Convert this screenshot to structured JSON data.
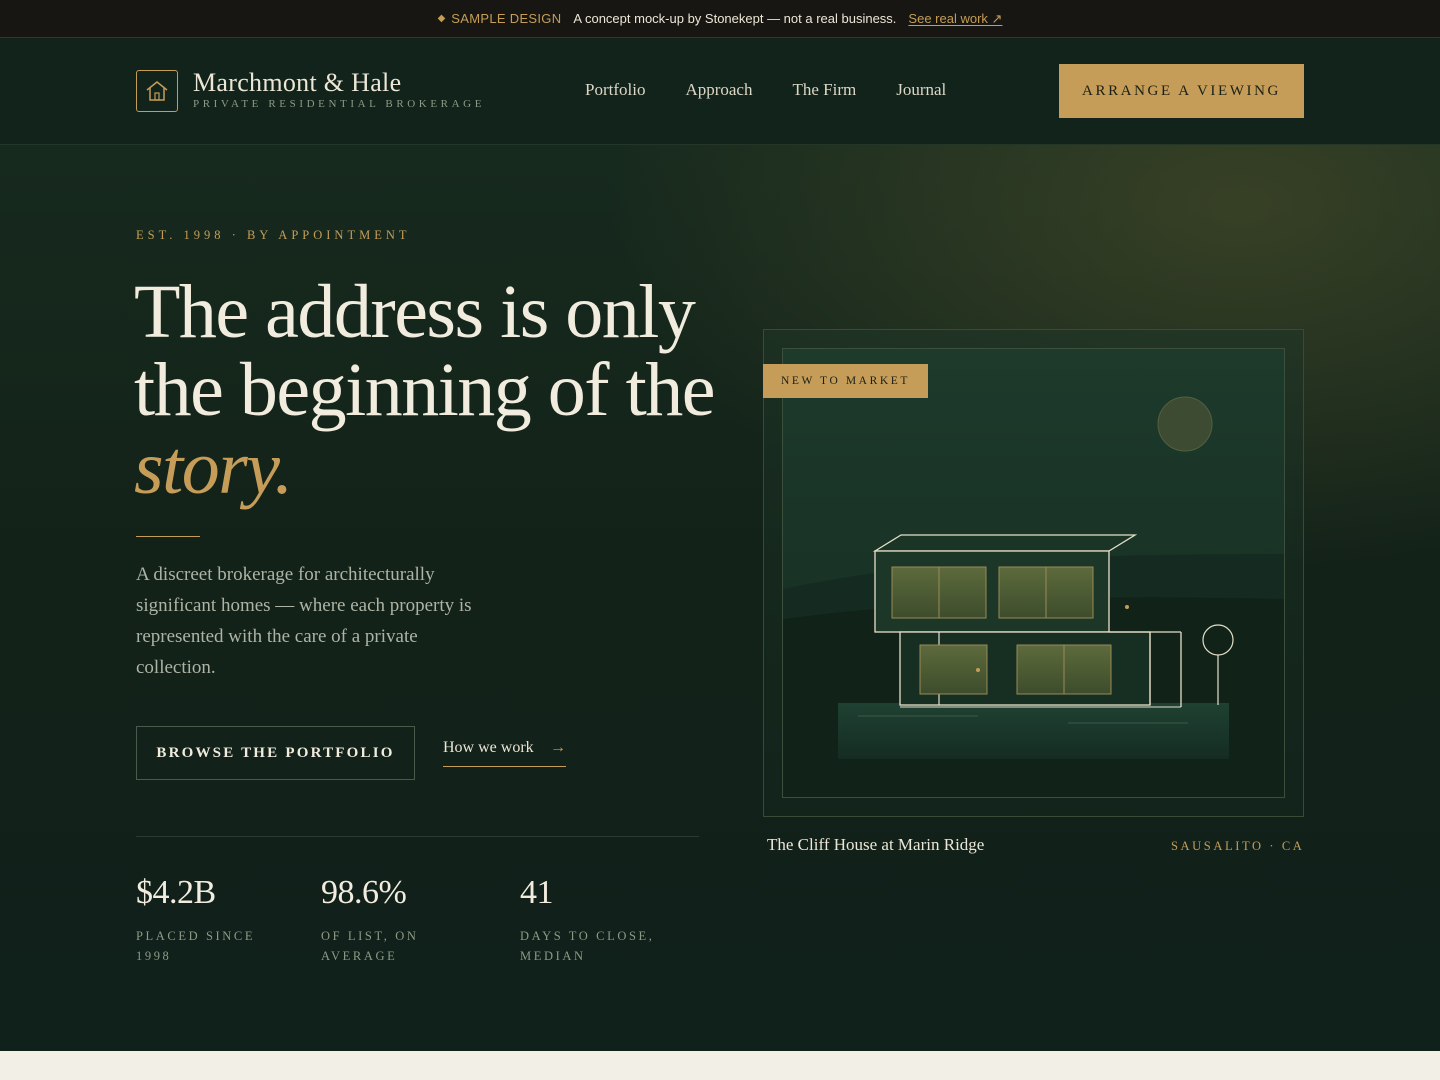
{
  "banner": {
    "tag": "SAMPLE DESIGN",
    "message": "A concept mock-up by Stonekept — not a real business.",
    "link": "See real work ↗"
  },
  "header": {
    "brand_name": "Marchmont & Hale",
    "brand_sub": "PRIVATE RESIDENTIAL BROKERAGE",
    "nav": [
      "Portfolio",
      "Approach",
      "The Firm",
      "Journal"
    ],
    "cta": "ARRANGE A VIEWING"
  },
  "hero": {
    "eyebrow": "EST. 1998 · BY APPOINTMENT",
    "headline_main": "The address is only the beginning of the ",
    "headline_accent": "story.",
    "lede": "A discreet brokerage for architecturally significant homes — where each property is represented with the care of a private collection.",
    "primary_button": "BROWSE THE PORTFOLIO",
    "secondary_link": "How we work",
    "secondary_arrow": "→",
    "stats": [
      {
        "value": "$4.2B",
        "label": "PLACED SINCE 1998"
      },
      {
        "value": "98.6%",
        "label": "OF LIST, ON AVERAGE"
      },
      {
        "value": "41",
        "label": "DAYS TO CLOSE, MEDIAN"
      }
    ]
  },
  "listing": {
    "badge": "NEW TO MARKET",
    "title": "The Cliff House at Marin Ridge",
    "location": "SAUSALITO · CA"
  },
  "colors": {
    "accent": "#c59d58",
    "background": "#132219",
    "text": "#ece6d6"
  },
  "icons": {
    "logo": "house-icon",
    "arrow": "arrow-right-icon"
  }
}
